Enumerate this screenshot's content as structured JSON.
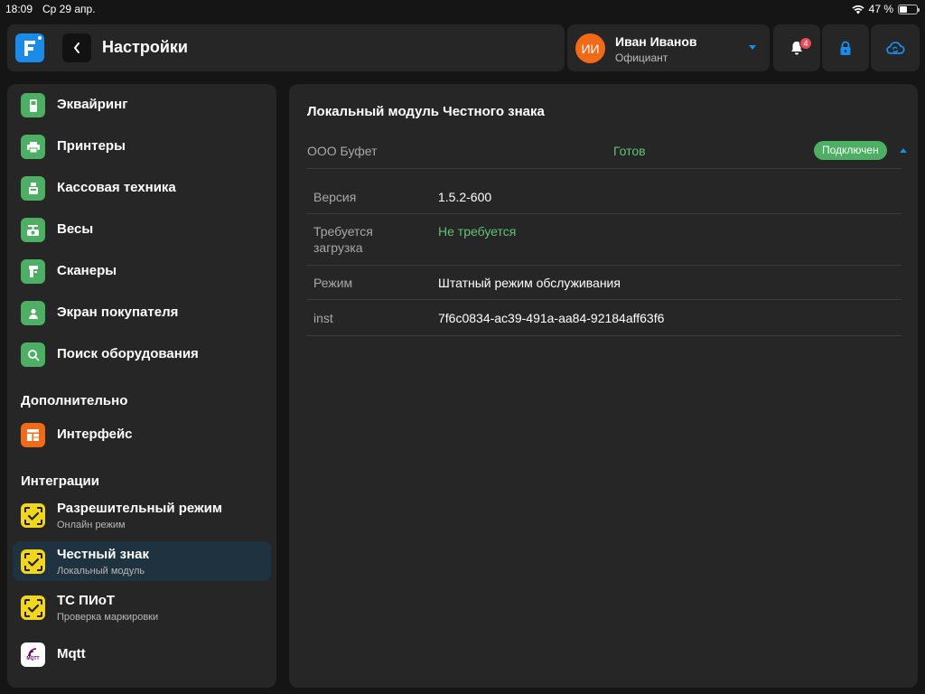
{
  "status_bar": {
    "time": "18:09",
    "date": "Ср 29 апр.",
    "battery": "47 %",
    "battery_level": 0.47
  },
  "header": {
    "title": "Настройки"
  },
  "user": {
    "initials": "ИИ",
    "name": "Иван Иванов",
    "role": "Официант"
  },
  "notifications": {
    "count": "4"
  },
  "sidebar": {
    "items": [
      {
        "label": "Эквайринг",
        "icon": "card-terminal-icon"
      },
      {
        "label": "Принтеры",
        "icon": "printer-icon"
      },
      {
        "label": "Кассовая техника",
        "icon": "cash-register-icon"
      },
      {
        "label": "Весы",
        "icon": "scales-icon"
      },
      {
        "label": "Сканеры",
        "icon": "scanner-icon"
      },
      {
        "label": "Экран покупателя",
        "icon": "customer-display-icon"
      },
      {
        "label": "Поиск оборудования",
        "icon": "search-icon"
      }
    ],
    "section_extra": "Дополнительно",
    "extra_items": [
      {
        "label": "Интерфейс",
        "icon": "layout-icon"
      }
    ],
    "section_integrations": "Интеграции",
    "integration_items": [
      {
        "label": "Разрешительный режим",
        "sub": "Онлайн режим",
        "icon": "marking-icon"
      },
      {
        "label": "Честный знак",
        "sub": "Локальный модуль",
        "icon": "marking-icon",
        "active": true
      },
      {
        "label": "ТС ПИоТ",
        "sub": "Проверка маркировки",
        "icon": "marking-icon"
      },
      {
        "label": "Mqtt",
        "icon": "mqtt-icon",
        "icon_text": "MQTT"
      }
    ]
  },
  "main": {
    "title": "Локальный модуль Честного знака",
    "org": {
      "name": "ООО Буфет",
      "status": "Готов",
      "badge": "Подключен"
    },
    "rows": [
      {
        "key": "Версия",
        "value": "1.5.2-600"
      },
      {
        "key": "Требуется загрузка",
        "value": "Не требуется"
      },
      {
        "key": "Режим",
        "value": "Штатный режим обслуживания"
      },
      {
        "key": "inst",
        "value": "7f6c0834-ac39-491a-aa84-92184aff63f6"
      }
    ]
  },
  "colors": {
    "accent_blue": "#1a8be8",
    "success_green": "#4caf63",
    "avatar_orange": "#f06a17",
    "marking_yellow": "#f2d61c",
    "badge_red": "#e74c5a"
  }
}
